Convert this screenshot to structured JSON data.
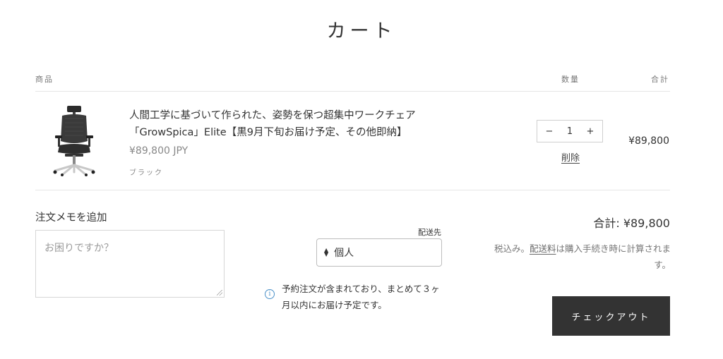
{
  "page": {
    "title": "カート"
  },
  "table": {
    "col_product": "商品",
    "col_quantity": "数量",
    "col_total": "合計"
  },
  "item": {
    "name": "人間工学に基づいて作られた、姿勢を保つ超集中ワークチェア「GrowSpica」Elite【黒9月下旬お届け予定、その他即納】",
    "price": "¥89,800 JPY",
    "variant": "ブラック",
    "quantity": "1",
    "decrease_label": "−",
    "increase_label": "+",
    "remove_label": "削除",
    "line_total": "¥89,800"
  },
  "note": {
    "label": "注文メモを追加",
    "placeholder": "お困りですか？"
  },
  "shipping": {
    "label": "配送先",
    "selected": "個人",
    "info": "予約注文が含まれており、まとめて３ヶ月以内にお届け予定です。"
  },
  "summary": {
    "subtotal": "合計: ¥89,800",
    "tax_prefix": "税込み。",
    "tax_link": "配送料",
    "tax_suffix": "は購入手続き時に計算されます。",
    "checkout_label": "チェックアウト"
  },
  "colors": {
    "checkout_bg": "#333333",
    "info_icon": "#4a90c8"
  }
}
